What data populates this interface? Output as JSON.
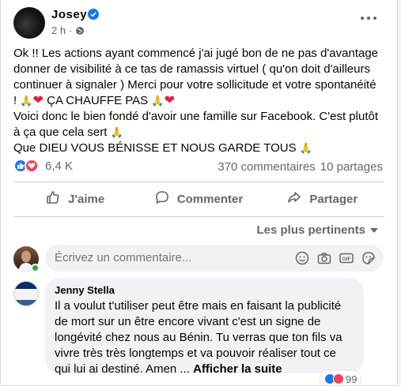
{
  "post": {
    "author": "Josey",
    "time": "2 h",
    "separator": "·",
    "lines": [
      "Ok !! Les actions ayant commencé j'ai jugé bon de ne pas d'avantage",
      "donner de visibilité à ce tas de ramassis virtuel ( qu'on doit d'ailleurs",
      "continuer à signaler ) Merci pour votre sollicitude et votre spontanéité",
      "ÇA CHAUFFE PAS",
      "Voici donc le bien fondé d'avoir une famille sur Facebook. C'est plutôt",
      "à ça que cela sert",
      "Que DIEU VOUS BÉNISSE ET NOUS GARDE TOUS"
    ],
    "line4_prefix": "!",
    "reactions_count": "6,4 K",
    "comments_count": "370 commentaires",
    "shares_count": "10 partages"
  },
  "actions": {
    "like": "J'aime",
    "comment": "Commenter",
    "share": "Partager"
  },
  "comments": {
    "sort_label": "Les plus pertinents",
    "input_placeholder": "Écrivez un commentaire...",
    "items": [
      {
        "author": "Jenny Stella",
        "lines": [
          "Il a voulut t'utiliser peut être mais en faisant la publicité",
          "de mort sur un être encore vivant c'est un signe de",
          "longévité chez nous au Bénin. Tu verras que ton fils va",
          "vivre très très longtemps et va pouvoir réaliser tout ce",
          "qui lui ai destiné. Amen ..."
        ],
        "see_more": "Afficher la suite",
        "reaction_count": "99"
      }
    ]
  },
  "colors": {
    "accent": "#1877f2",
    "love": "#f33e58",
    "online": "#31a24c"
  }
}
